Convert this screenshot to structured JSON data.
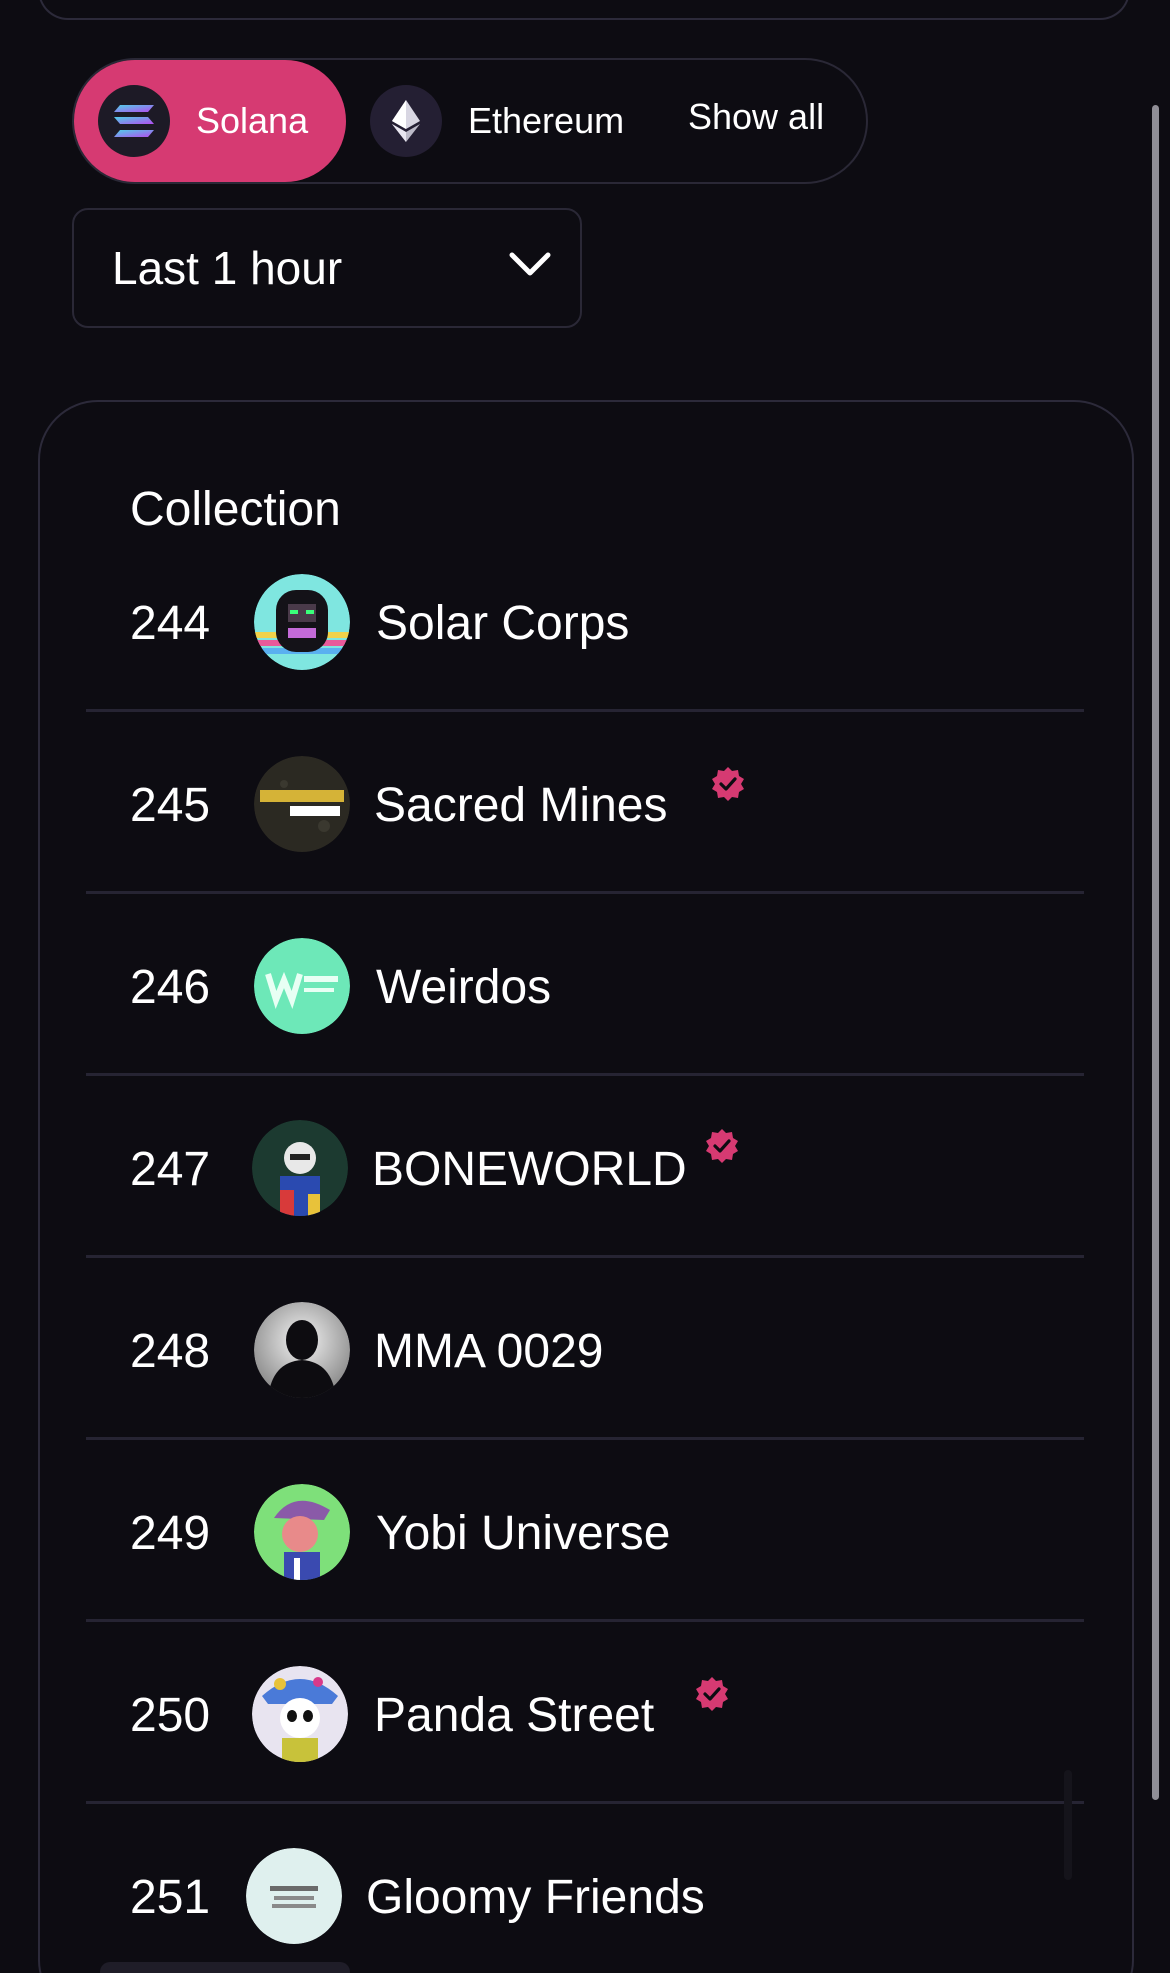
{
  "chains": {
    "solana_label": "Solana",
    "ethereum_label": "Ethereum",
    "show_all_label": "Show all",
    "selected": "Solana"
  },
  "time_filter": {
    "selected": "Last 1 hour"
  },
  "table": {
    "column_header": "Collection",
    "rows": [
      {
        "rank": "244",
        "name": "Solar Corps",
        "verified": false
      },
      {
        "rank": "245",
        "name": "Sacred Mines",
        "verified": true
      },
      {
        "rank": "246",
        "name": "Weirdos",
        "verified": false
      },
      {
        "rank": "247",
        "name": "BONEWORLD",
        "verified": true
      },
      {
        "rank": "248",
        "name": "MMA 0029",
        "verified": false
      },
      {
        "rank": "249",
        "name": "Yobi Universe",
        "verified": false
      },
      {
        "rank": "250",
        "name": "Panda Street",
        "verified": true
      },
      {
        "rank": "251",
        "name": "Gloomy Friends",
        "verified": false
      }
    ]
  },
  "colors": {
    "accent": "#d63a72",
    "background": "#0d0c12",
    "border": "#2a2836"
  }
}
